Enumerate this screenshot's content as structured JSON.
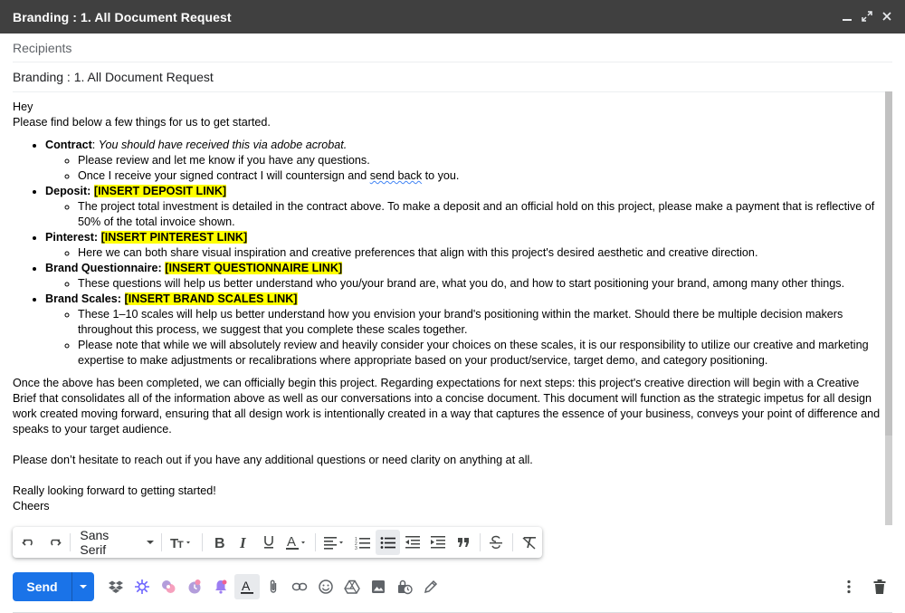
{
  "window": {
    "title": "Branding : 1. All Document Request",
    "controls": [
      "minimize-icon",
      "popout-icon",
      "close-icon"
    ]
  },
  "recipients": {
    "placeholder": "Recipients"
  },
  "subject": {
    "value": "Branding : 1. All Document Request"
  },
  "body": {
    "greeting": "Hey",
    "intro": "Please find below a few things for us to get started.",
    "items": [
      {
        "label": "Contract",
        "after_label": ": ",
        "note": "You should have received this via adobe acrobat.",
        "subitems": [
          {
            "text": "Please review and let me know if you have any questions."
          },
          {
            "text_before": "Once I receive your signed contract I will countersign and ",
            "squiggle": "send back",
            "text_after": " to you."
          }
        ]
      },
      {
        "label": "Deposit:",
        "link": "[INSERT DEPOSIT LINK]",
        "subitems": [
          {
            "text": "The project total investment is detailed in the contract above. To make a deposit and an official hold on this project, please make a payment that is reflective of 50% of the total invoice shown."
          }
        ]
      },
      {
        "label": "Pinterest:",
        "link": "[INSERT PINTEREST LINK]",
        "subitems": [
          {
            "text": "Here we can both share visual inspiration and creative preferences that align with this project's desired aesthetic and creative direction."
          }
        ]
      },
      {
        "label": "Brand Questionnaire:",
        "link": "[INSERT QUESTIONNAIRE LINK]",
        "subitems": [
          {
            "text": "These questions will help us better understand who you/your brand are, what you do, and how to start positioning your brand, among many other things."
          }
        ]
      },
      {
        "label": "Brand Scales:",
        "link": "[INSERT BRAND SCALES LINK]",
        "subitems": [
          {
            "text": "These 1–10 scales will help us better understand how you envision your brand's positioning within the market. Should there be multiple decision makers throughout this process, we suggest that you complete these scales together."
          },
          {
            "text": "Please note that while we will absolutely review and heavily consider your choices on these scales, it is our responsibility to utilize our creative and marketing expertise to make adjustments or recalibrations where appropriate based on your product/service, target demo, and category positioning."
          }
        ]
      }
    ],
    "paragraph_next_steps": "Once the above has been completed, we can officially begin this project. Regarding expectations for next steps: this project's creative direction will begin with a Creative Brief that consolidates all of the information above as well as our conversations into a concise document. This document will function as the strategic impetus for all design work created moving forward, ensuring that all design work is intentionally created in a way that captures the essence of your business, conveys your point of difference and speaks to your target audience.",
    "paragraph_contact": "Please don’t hesitate to reach out if you have any additional questions or need clarity on anything at all.",
    "closing_1": "Really looking forward to getting started!",
    "closing_2": "Cheers"
  },
  "format_toolbar": {
    "font_name": "Sans Serif",
    "buttons": [
      "undo-icon",
      "redo-icon",
      "font-size-icon",
      "bold-icon",
      "italic-icon",
      "underline-icon",
      "text-color-icon",
      "align-icon",
      "numbered-list-icon",
      "bulleted-list-icon",
      "indent-less-icon",
      "indent-more-icon",
      "quote-icon",
      "strikethrough-icon",
      "clear-formatting-icon"
    ],
    "active": "bulleted-list-icon"
  },
  "bottom_toolbar": {
    "send_label": "Send",
    "icons": [
      "dropbox-icon",
      "star-burst-icon",
      "addon-icon",
      "addon-clock-icon",
      "bell-icon",
      "formatting-options-icon",
      "attach-icon",
      "link-icon",
      "emoji-icon",
      "drive-icon",
      "photo-icon",
      "schedule-lock-icon",
      "signature-icon",
      "more-options-icon",
      "trash-icon"
    ]
  },
  "colors": {
    "titlebar": "#404040",
    "send": "#1a73e8",
    "highlight": "#ffff00"
  }
}
